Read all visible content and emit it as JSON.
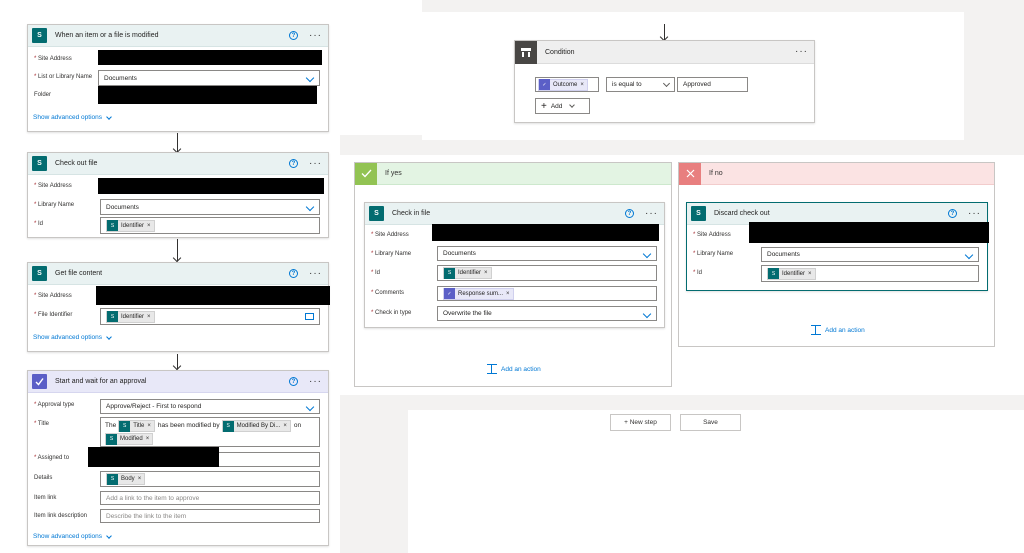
{
  "trigger": {
    "title": "When an item or a file is modified",
    "icon": "sharepoint-icon",
    "site_label": "Site Address",
    "list_label": "List or Library Name",
    "list_value": "Documents",
    "folder_label": "Folder",
    "advanced": "Show advanced options"
  },
  "checkout": {
    "title": "Check out file",
    "site_label": "Site Address",
    "lib_label": "Library Name",
    "lib_value": "Documents",
    "id_label": "Id",
    "id_token": "Identifier"
  },
  "getfile": {
    "title": "Get file content",
    "site_label": "Site Address",
    "fileid_label": "File Identifier",
    "fileid_token": "Identifier",
    "advanced": "Show advanced options"
  },
  "approval": {
    "title": "Start and wait for an approval",
    "type_label": "Approval type",
    "type_value": "Approve/Reject - First to respond",
    "title_label": "Title",
    "title_text_1": "The",
    "title_token_1": "Title",
    "title_text_2": "has been modified by",
    "title_token_2": "Modified By Di...",
    "title_text_3": "on",
    "title_token_3": "Modified",
    "assigned_label": "Assigned to",
    "details_label": "Details",
    "details_token": "Body",
    "itemlink_label": "Item link",
    "itemlink_placeholder": "Add a link to the item to approve",
    "itemlinkdesc_label": "Item link description",
    "itemlinkdesc_placeholder": "Describe the link to the item",
    "advanced": "Show advanced options"
  },
  "condition": {
    "title": "Condition",
    "token": "Outcome",
    "operator": "is equal to",
    "value": "Approved",
    "add_label": "Add"
  },
  "yes_branch": {
    "title": "If yes",
    "action_title": "Check in file",
    "site_label": "Site Address",
    "lib_label": "Library Name",
    "lib_value": "Documents",
    "id_label": "Id",
    "id_token": "Identifier",
    "comments_label": "Comments",
    "comments_token": "Response sum...",
    "checkin_label": "Check in type",
    "checkin_value": "Overwrite the file",
    "add_action": "Add an action"
  },
  "no_branch": {
    "title": "If no",
    "action_title": "Discard check out",
    "site_label": "Site Address",
    "lib_label": "Library Name",
    "lib_value": "Documents",
    "id_label": "Id",
    "id_token": "Identifier",
    "add_action": "Add an action"
  },
  "footer": {
    "new_step": "+ New step",
    "save": "Save"
  },
  "colors": {
    "sharepoint": "#036c70",
    "approvals": "#5b5fc7",
    "link": "#0078d4",
    "yes": "#92c353",
    "no": "#e87f7f"
  }
}
